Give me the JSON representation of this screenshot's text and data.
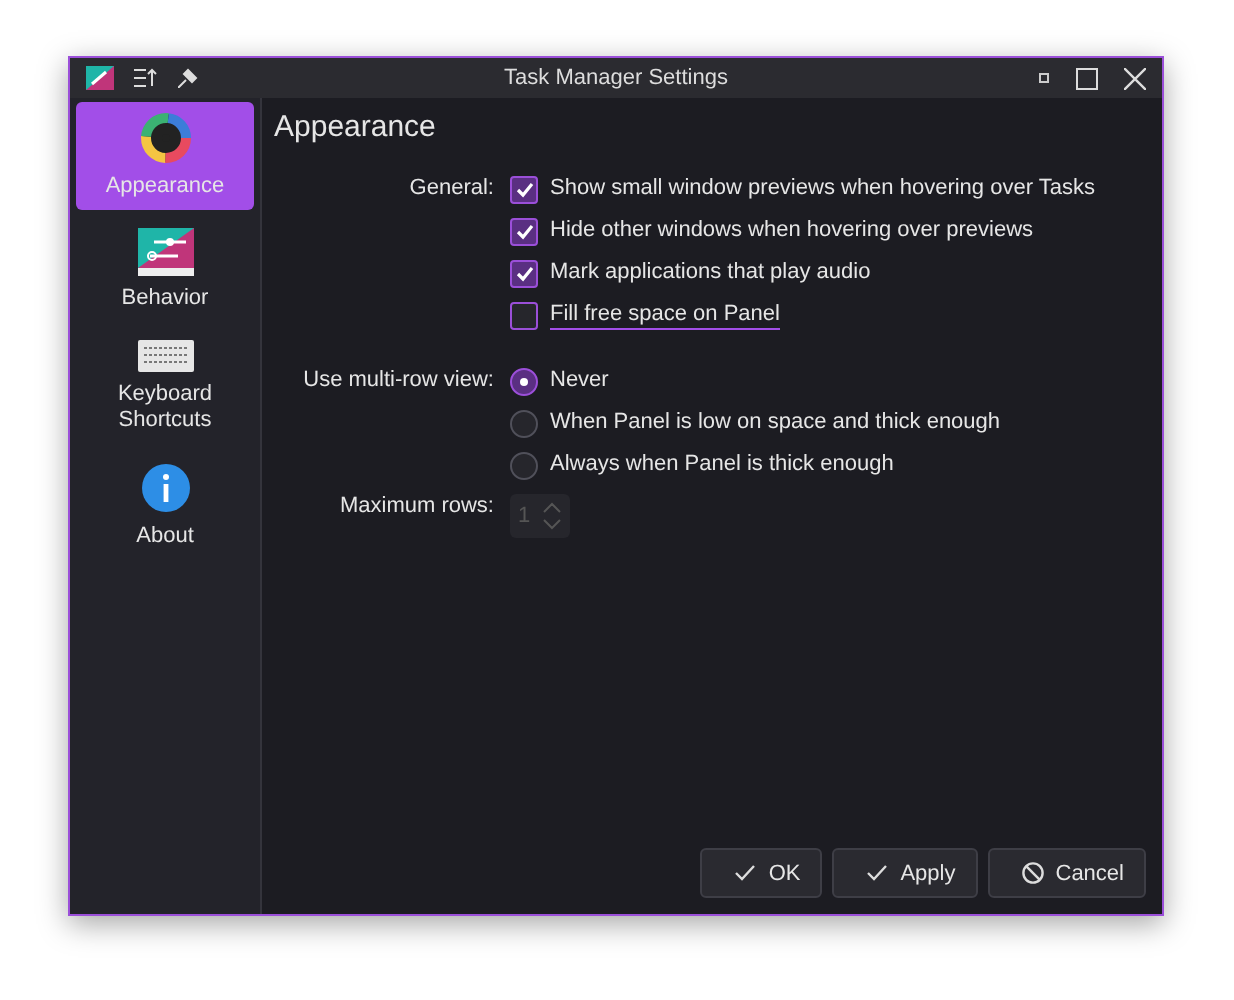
{
  "window": {
    "title": "Task Manager Settings"
  },
  "sidebar": {
    "items": [
      {
        "label": "Appearance",
        "kind": "palette",
        "selected": true
      },
      {
        "label": "Behavior",
        "kind": "sliders",
        "selected": false
      },
      {
        "label": "Keyboard Shortcuts",
        "kind": "keyboard",
        "selected": false
      },
      {
        "label": "About",
        "kind": "info",
        "selected": false
      }
    ]
  },
  "page": {
    "heading": "Appearance",
    "general": {
      "label": "General:",
      "options": [
        {
          "label": "Show small window previews when hovering over Tasks",
          "checked": true,
          "focused": false
        },
        {
          "label": "Hide other windows when hovering over previews",
          "checked": true,
          "focused": false
        },
        {
          "label": "Mark applications that play audio",
          "checked": true,
          "focused": false
        },
        {
          "label": "Fill free space on Panel",
          "checked": false,
          "focused": true
        }
      ]
    },
    "multirow": {
      "label": "Use multi-row view:",
      "options": [
        {
          "label": "Never",
          "selected": true
        },
        {
          "label": "When Panel is low on space and thick enough",
          "selected": false
        },
        {
          "label": "Always when Panel is thick enough",
          "selected": false
        }
      ]
    },
    "max_rows": {
      "label": "Maximum rows:",
      "value": "1",
      "disabled": true
    }
  },
  "buttons": [
    {
      "label": "OK",
      "kind": "check"
    },
    {
      "label": "Apply",
      "kind": "check"
    },
    {
      "label": "Cancel",
      "kind": "cancel"
    }
  ]
}
